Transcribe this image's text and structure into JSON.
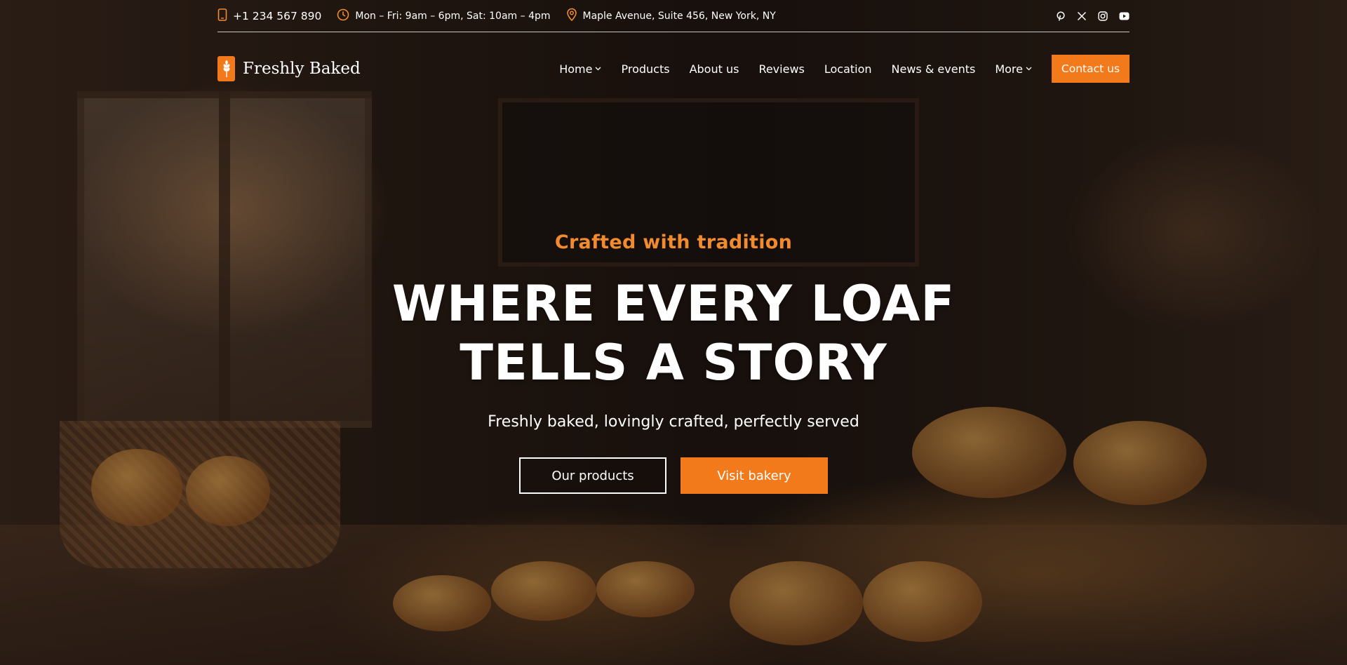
{
  "topbar": {
    "phone": "+1 234 567 890",
    "hours": "Mon – Fri: 9am – 6pm, Sat: 10am – 4pm",
    "address": "Maple Avenue, Suite 456, New York, NY",
    "social_icons": [
      "pinterest-icon",
      "x-icon",
      "instagram-icon",
      "youtube-icon"
    ]
  },
  "brand": {
    "name": "Freshly Baked",
    "logo_icon": "wheat-icon"
  },
  "nav": {
    "items": [
      {
        "label": "Home",
        "dropdown": true
      },
      {
        "label": "Products",
        "dropdown": false
      },
      {
        "label": "About us",
        "dropdown": false
      },
      {
        "label": "Reviews",
        "dropdown": false
      },
      {
        "label": "Location",
        "dropdown": false
      },
      {
        "label": "News & events",
        "dropdown": false
      },
      {
        "label": "More",
        "dropdown": true
      }
    ],
    "cta_label": "Contact us"
  },
  "hero": {
    "eyebrow": "Crafted with tradition",
    "headline_line1": "WHERE EVERY LOAF",
    "headline_line2": "TELLS A STORY",
    "subline": "Freshly baked, lovingly crafted, perfectly served",
    "primary_button": "Our products",
    "secondary_button": "Visit bakery"
  },
  "colors": {
    "accent": "#f27a1a",
    "eyebrow": "#f28a2e",
    "text": "#ffffff"
  }
}
